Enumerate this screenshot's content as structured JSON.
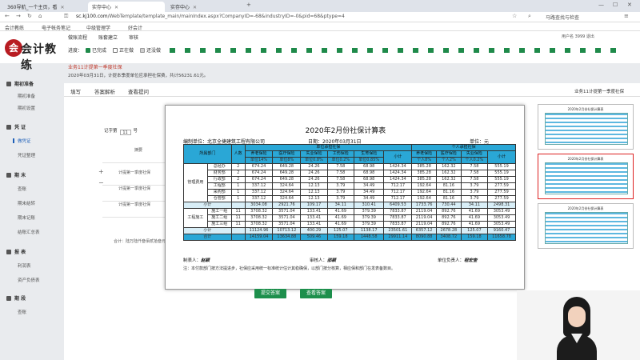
{
  "browser": {
    "tabs": [
      {
        "label": "360导航_一个主页，看",
        "active": false
      },
      {
        "label": "实存中心",
        "active": true
      },
      {
        "label": "实存中心",
        "active": false
      }
    ],
    "url_prefix": "sc.kj100.com",
    "url_rest": "/WebTemplate/template_main/mainIndex.aspx?CompanyID=-68&industryID=-0&pid=68&ptype=4",
    "right_text": "马路查找与检查",
    "bookmarks": [
      "会计教练",
      "电子帐务笔记",
      "中级管理学",
      "好会计"
    ]
  },
  "header": {
    "logo_text": "会计教练",
    "logo_mark": "会",
    "top_tabs": [
      "做账流程",
      "账套建立",
      "审核"
    ],
    "status_label": "进度：",
    "status": [
      {
        "label": "已完成",
        "color": "#1f8a4a"
      },
      {
        "label": "正在做",
        "color": "#ffffff"
      },
      {
        "label": "还没做",
        "color": "#cfcfcf"
      }
    ],
    "progress_segments": 30,
    "user": "用户名 3999   退出"
  },
  "task_title": "业务11计提第一季度社保",
  "task_desc": "2020年03月31日，计提本季度单位应承担社保费，共计56231.61元。",
  "sidebar": {
    "groups": [
      {
        "label": "期初准备",
        "items": [
          "期初准备",
          "期初设置"
        ]
      },
      {
        "label": "凭 证",
        "items": [
          "做凭证",
          "凭证整理"
        ]
      },
      {
        "label": "期 末",
        "items": [
          "查账",
          "期末结转",
          "期末记账",
          "结账汇总表"
        ]
      },
      {
        "label": "报 表",
        "items": [
          "利润表",
          "资产负债表"
        ]
      },
      {
        "label": "期 段",
        "items": [
          "查账"
        ]
      }
    ],
    "active_item": "做凭证"
  },
  "main": {
    "subtabs": [
      "填写",
      "答案解析",
      "查看提问"
    ],
    "right_link": "业务11计提第一季度社保",
    "voucher_label": "记字第",
    "voucher_no": "11",
    "voucher_unit": "号",
    "summary_header": "摘要",
    "rows": [
      "计提第一季度社保",
      "计提第一季度社保",
      "计提第一季度社保"
    ],
    "note": "合计：陆万陆仟叁佰贰拾叁元叁角"
  },
  "sheet": {
    "title": "2020年2月份社保计算表",
    "company": "编制单位：北京全捷建筑工程有限公司",
    "date": "日期：2020年03月31日",
    "unit": "单位：元",
    "headers": {
      "dept": "所属部门",
      "people": "人数",
      "unit_group": "单位承担社保",
      "personal_group": "个人承担社保",
      "cols": [
        "养老保险",
        "医疗保险",
        "失业保险",
        "工伤保险",
        "生育保险",
        "小计"
      ],
      "unit_rates": [
        "单位14%",
        "单位8%",
        "单位0.8%",
        "单位0.2%",
        "单位0.85%"
      ],
      "personal_cols": [
        "养老保险",
        "医疗保险",
        "失业保险",
        "小计"
      ],
      "personal_rates": [
        "个人8%",
        "个人2%",
        "个人0.2%"
      ]
    },
    "group1": "管理费用",
    "group2": "工程施工",
    "rows": [
      [
        "总经办",
        "2",
        "674.24",
        "649.28",
        "24.26",
        "7.58",
        "68.98",
        "1424.34",
        "385.28",
        "162.32",
        "7.58",
        "555.19"
      ],
      [
        "财务部",
        "2",
        "674.24",
        "649.28",
        "24.26",
        "7.58",
        "68.98",
        "1424.34",
        "385.28",
        "162.32",
        "7.58",
        "555.19"
      ],
      [
        "行政部",
        "2",
        "674.24",
        "649.28",
        "24.26",
        "7.58",
        "68.98",
        "1424.34",
        "385.28",
        "162.32",
        "7.58",
        "555.19"
      ],
      [
        "工程部",
        "1",
        "337.12",
        "324.64",
        "12.13",
        "3.79",
        "34.49",
        "712.17",
        "192.64",
        "81.16",
        "3.79",
        "277.59"
      ],
      [
        "采购部",
        "1",
        "337.12",
        "324.64",
        "12.13",
        "3.79",
        "34.49",
        "712.17",
        "192.64",
        "81.16",
        "3.79",
        "277.59"
      ],
      [
        "仓管部",
        "1",
        "337.12",
        "324.64",
        "12.13",
        "3.79",
        "34.49",
        "712.17",
        "192.64",
        "81.16",
        "3.79",
        "277.59"
      ],
      [
        "小计",
        "",
        "3034.08",
        "2921.76",
        "109.17",
        "34.11",
        "310.41",
        "6409.53",
        "1733.76",
        "730.44",
        "34.11",
        "2498.31"
      ],
      [
        "施工一组",
        "11",
        "3708.32",
        "3571.04",
        "133.41",
        "41.69",
        "379.39",
        "7833.87",
        "2119.04",
        "892.76",
        "41.69",
        "3053.49"
      ],
      [
        "施工二组",
        "11",
        "3708.32",
        "3571.04",
        "133.41",
        "41.69",
        "379.39",
        "7833.87",
        "2119.04",
        "892.76",
        "41.69",
        "3053.49"
      ],
      [
        "施工三组",
        "11",
        "3708.32",
        "3571.04",
        "133.41",
        "41.69",
        "379.39",
        "7833.87",
        "2119.04",
        "892.76",
        "41.69",
        "3053.49"
      ],
      [
        "小计",
        "",
        "11124.96",
        "10713.12",
        "400.29",
        "125.07",
        "1138.17",
        "23501.61",
        "6357.12",
        "2678.28",
        "125.07",
        "9160.47"
      ],
      [
        "合计",
        "",
        "14159.04",
        "13634.88",
        "509.46",
        "159.18",
        "1448.58",
        "29911.14",
        "8090.88",
        "3408.72",
        "159.18",
        "11658.78"
      ]
    ],
    "preparer": "制表人：",
    "preparer_sig": "赵颖",
    "approver": "审核人：",
    "approver_sig": "邵颖",
    "manager": "单位负责人：",
    "manager_sig": "程宏奎",
    "note": "注：本付款部门按方法提进步，社保应采用统一标准统计估计其稳确保，以部门按分核算，相应保和部门在发表备数目。"
  },
  "buttons": {
    "submit": "提交答案",
    "view": "查看答案"
  },
  "thumbs": [
    "2020年2月份社保计算表",
    "2020年2月份社保计算表",
    "2020年2月份社保计算表"
  ]
}
